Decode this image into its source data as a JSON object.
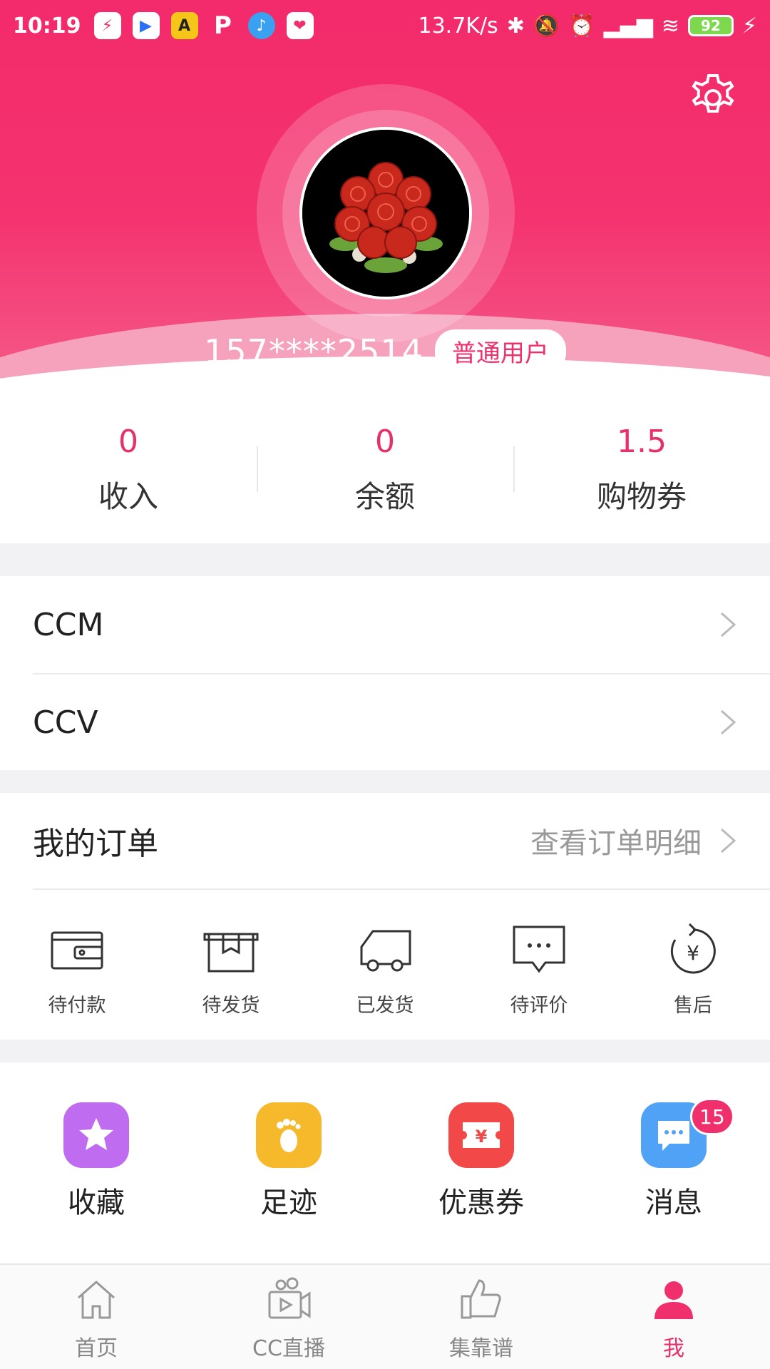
{
  "status_bar": {
    "time": "10:19",
    "net_speed": "13.7K/s",
    "battery": "92",
    "apps": [
      {
        "name": "shield-app-icon",
        "color": "#f0306c",
        "glyph": "⚡"
      },
      {
        "name": "youku-app-icon",
        "color": "#2b6ff2",
        "glyph": "▶"
      },
      {
        "name": "taxi-app-icon",
        "color": "#f5c518",
        "glyph": "A"
      },
      {
        "name": "p-app-icon",
        "color": "#f0306c",
        "glyph": "P"
      },
      {
        "name": "music-app-icon",
        "color": "#3aa0f0",
        "glyph": "♪"
      },
      {
        "name": "heart-app-icon",
        "color": "#f0306c",
        "glyph": "❤"
      }
    ]
  },
  "profile": {
    "phone": "157****2514",
    "tag": "普通用户"
  },
  "stats": [
    {
      "value": "0",
      "label": "收入"
    },
    {
      "value": "0",
      "label": "余额"
    },
    {
      "value": "1.5",
      "label": "购物券"
    }
  ],
  "menu": [
    {
      "label": "CCM"
    },
    {
      "label": "CCV"
    }
  ],
  "orders": {
    "title": "我的订单",
    "link": "查看订单明细",
    "items": [
      {
        "label": "待付款",
        "icon": "wallet-icon"
      },
      {
        "label": "待发货",
        "icon": "package-icon"
      },
      {
        "label": "已发货",
        "icon": "truck-icon"
      },
      {
        "label": "待评价",
        "icon": "comment-icon"
      },
      {
        "label": "售后",
        "icon": "after-sale-icon"
      }
    ]
  },
  "quick": [
    {
      "label": "收藏",
      "icon": "star-icon",
      "color": "#c06cf0"
    },
    {
      "label": "足迹",
      "icon": "footprint-icon",
      "color": "#f7b92c"
    },
    {
      "label": "优惠券",
      "icon": "coupon-icon",
      "color": "#f24848"
    },
    {
      "label": "消息",
      "icon": "message-icon",
      "color": "#4fa2f5",
      "badge": "15"
    }
  ],
  "tabs": [
    {
      "label": "首页",
      "icon": "home-icon"
    },
    {
      "label": "CC直播",
      "icon": "live-camera-icon"
    },
    {
      "label": "集靠谱",
      "icon": "thumbs-up-icon"
    },
    {
      "label": "我",
      "icon": "profile-icon",
      "active": true
    }
  ],
  "colors": {
    "accent": "#f0306c",
    "header": "#f32a6b"
  }
}
